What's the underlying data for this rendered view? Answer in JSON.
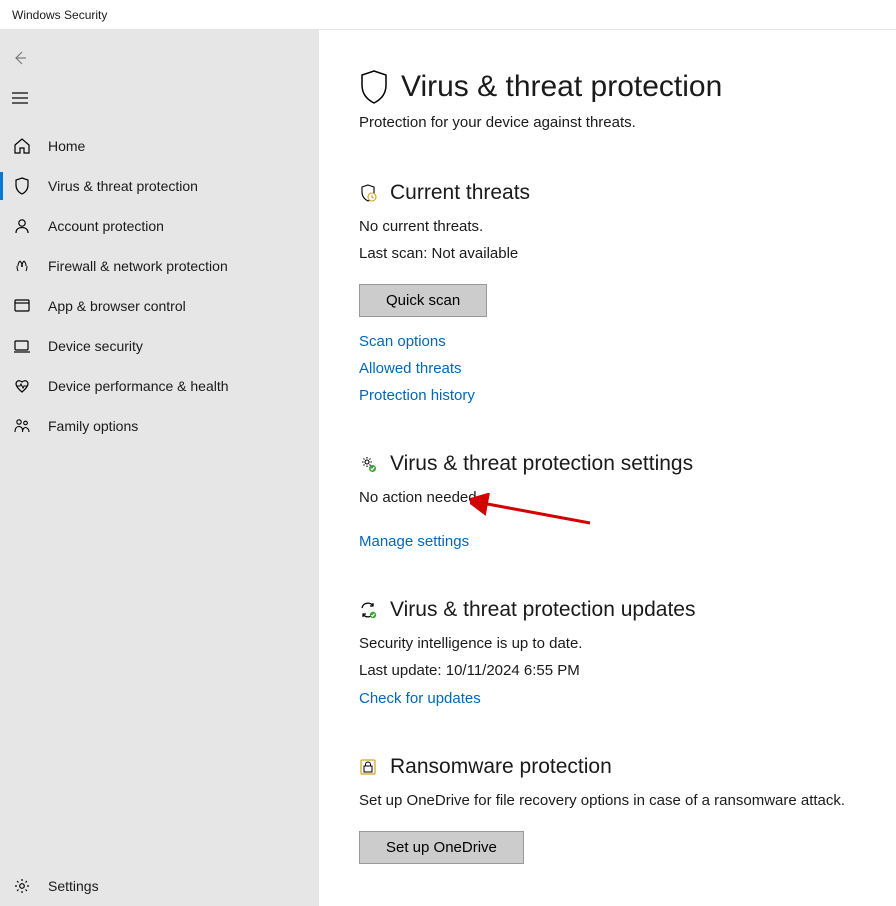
{
  "window": {
    "title": "Windows Security"
  },
  "sidebar": {
    "items": [
      {
        "label": "Home"
      },
      {
        "label": "Virus & threat protection"
      },
      {
        "label": "Account protection"
      },
      {
        "label": "Firewall & network protection"
      },
      {
        "label": "App & browser control"
      },
      {
        "label": "Device security"
      },
      {
        "label": "Device performance & health"
      },
      {
        "label": "Family options"
      }
    ],
    "settings_label": "Settings"
  },
  "page": {
    "title": "Virus & threat protection",
    "subtitle": "Protection for your device against threats."
  },
  "current_threats": {
    "title": "Current threats",
    "status1": "No current threats.",
    "status2": "Last scan: Not available",
    "quick_scan_label": "Quick scan",
    "links": {
      "scan_options": "Scan options",
      "allowed_threats": "Allowed threats",
      "protection_history": "Protection history"
    }
  },
  "vtp_settings": {
    "title": "Virus & threat protection settings",
    "status": "No action needed.",
    "manage_link": "Manage settings"
  },
  "vtp_updates": {
    "title": "Virus & threat protection updates",
    "status1": "Security intelligence is up to date.",
    "status2": "Last update: 10/11/2024 6:55 PM",
    "check_link": "Check for updates"
  },
  "ransomware": {
    "title": "Ransomware protection",
    "status": "Set up OneDrive for file recovery options in case of a ransomware attack.",
    "button_label": "Set up OneDrive"
  },
  "annotation": {
    "arrow_color": "#d40000"
  }
}
